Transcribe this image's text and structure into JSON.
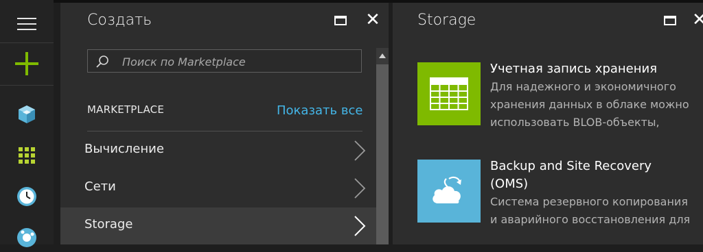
{
  "nav_rail": {
    "icons": [
      "hamburger-menu-icon",
      "plus-icon",
      "cube-icon",
      "grid-icon",
      "clock-icon",
      "globe-icon"
    ]
  },
  "create_blade": {
    "title": "Создать",
    "search_placeholder": "Поиск по Marketplace",
    "section_label": "MARKETPLACE",
    "show_all_label": "Показать все",
    "menu_items": [
      {
        "label": "Вычисление"
      },
      {
        "label": "Сети"
      },
      {
        "label": "Storage"
      }
    ]
  },
  "storage_blade": {
    "title": "Storage",
    "items": [
      {
        "title": "Учетная запись хранения",
        "desc_lines": [
          "Для надежного и экономичного",
          "хранения данных в облаке можно",
          "использовать BLOB-объекты,"
        ],
        "icon": "table-icon",
        "color": "#7fba00"
      },
      {
        "title_lines": [
          "Backup and Site Recovery",
          "(OMS)"
        ],
        "desc_lines": [
          "Система резервного копирования",
          "и аварийного восстановления для"
        ],
        "icon": "cloud-icon",
        "color": "#59b4d9"
      }
    ]
  },
  "colors": {
    "accent_link": "#44b6e8",
    "green": "#7fba00",
    "blue": "#59b4d9",
    "background": "#2d2d2d"
  }
}
